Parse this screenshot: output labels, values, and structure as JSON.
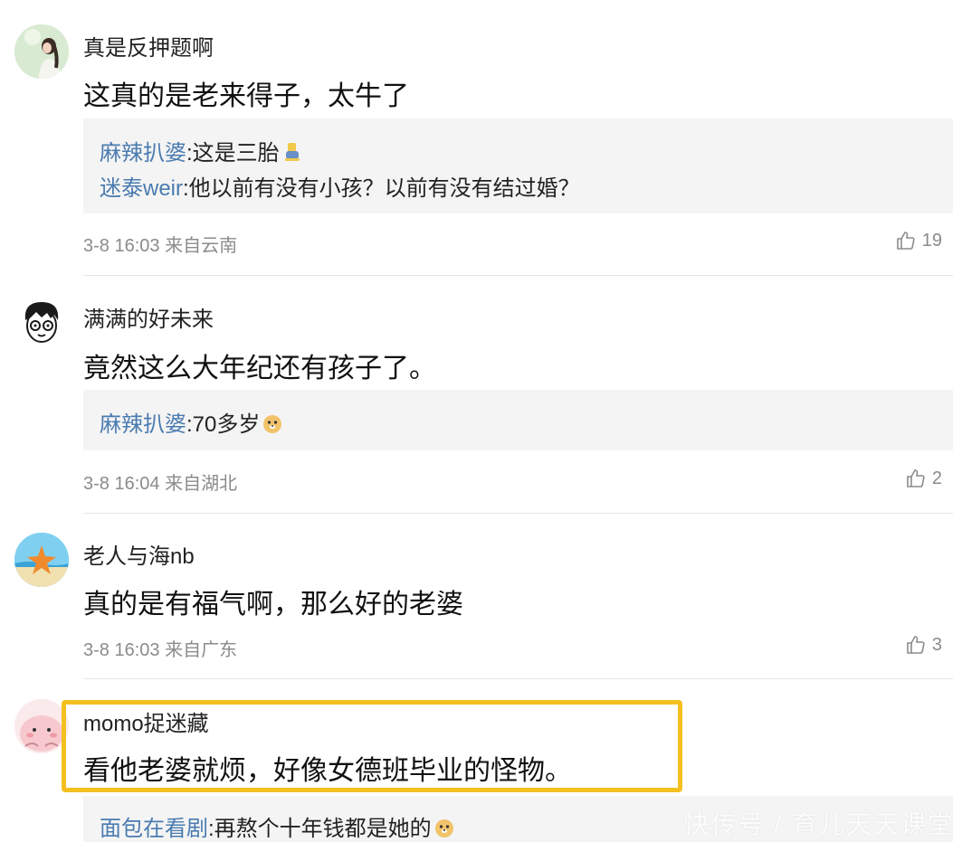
{
  "comments": [
    {
      "username": "真是反押题啊",
      "text": "这真的是老来得子，太牛了",
      "replies": [
        {
          "user": "麻辣扒婆",
          "text": ":这是三胎",
          "emoji": "thumbs-down-emoji"
        },
        {
          "user": "迷泰weir",
          "text": ":他以前有没有小孩？以前有没有结过婚？"
        }
      ],
      "time": "3-8 16:03 来自云南",
      "likes": "19"
    },
    {
      "username": "满满的好未来",
      "text": "竟然这么大年纪还有孩子了。",
      "replies": [
        {
          "user": "麻辣扒婆",
          "text": ":70多岁",
          "emoji": "doge-emoji"
        }
      ],
      "time": "3-8 16:04 来自湖北",
      "likes": "2"
    },
    {
      "username": "老人与海nb",
      "text": "真的是有福气啊，那么好的老婆",
      "time": "3-8 16:03 来自广东",
      "likes": "3"
    },
    {
      "username": "momo捉迷藏",
      "text": "看他老婆就烦，好像女德班毕业的怪物。",
      "replies": [
        {
          "user": "面包在看剧",
          "text": ":再熬个十年钱都是她的",
          "emoji": "doge-emoji"
        }
      ]
    }
  ],
  "icons": {
    "like": "thumbs-up-icon"
  },
  "colors": {
    "reply_user": "#4a7bb0",
    "highlight": "#f4c020",
    "reply_bg": "#f4f4f4"
  },
  "watermark": "快传号 / 育儿天天课堂"
}
